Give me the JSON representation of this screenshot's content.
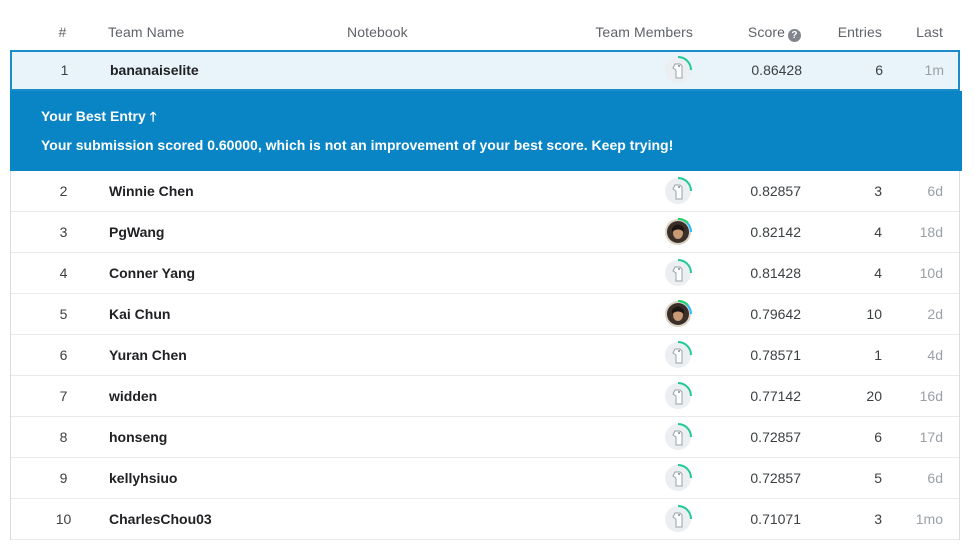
{
  "header": {
    "rank": "#",
    "team_name": "Team Name",
    "notebook": "Notebook",
    "team_members": "Team Members",
    "score": "Score",
    "entries": "Entries",
    "last": "Last"
  },
  "accent_color": "#0984c5",
  "highlight_row": {
    "rank": "1",
    "name": "bananaiselite",
    "score": "0.86428",
    "entries": "6",
    "last": "1m",
    "avatar": "default-avatar"
  },
  "banner": {
    "title": "Your Best Entry",
    "message": "Your submission scored 0.60000, which is not an improvement of your best score. Keep trying!"
  },
  "rows": [
    {
      "rank": "2",
      "name": "Winnie Chen",
      "score": "0.82857",
      "entries": "3",
      "last": "6d",
      "avatar": "default-avatar"
    },
    {
      "rank": "3",
      "name": "PgWang",
      "score": "0.82142",
      "entries": "4",
      "last": "18d",
      "avatar": "photo-avatar"
    },
    {
      "rank": "4",
      "name": "Conner Yang",
      "score": "0.81428",
      "entries": "4",
      "last": "10d",
      "avatar": "default-avatar"
    },
    {
      "rank": "5",
      "name": "Kai Chun",
      "score": "0.79642",
      "entries": "10",
      "last": "2d",
      "avatar": "photo-avatar"
    },
    {
      "rank": "6",
      "name": "Yuran Chen",
      "score": "0.78571",
      "entries": "1",
      "last": "4d",
      "avatar": "default-avatar"
    },
    {
      "rank": "7",
      "name": "widden",
      "score": "0.77142",
      "entries": "20",
      "last": "16d",
      "avatar": "default-avatar"
    },
    {
      "rank": "8",
      "name": "honseng",
      "score": "0.72857",
      "entries": "6",
      "last": "17d",
      "avatar": "default-avatar"
    },
    {
      "rank": "9",
      "name": "kellyhsiuo",
      "score": "0.72857",
      "entries": "5",
      "last": "6d",
      "avatar": "default-avatar"
    },
    {
      "rank": "10",
      "name": "CharlesChou03",
      "score": "0.71071",
      "entries": "3",
      "last": "1mo",
      "avatar": "default-avatar"
    }
  ]
}
